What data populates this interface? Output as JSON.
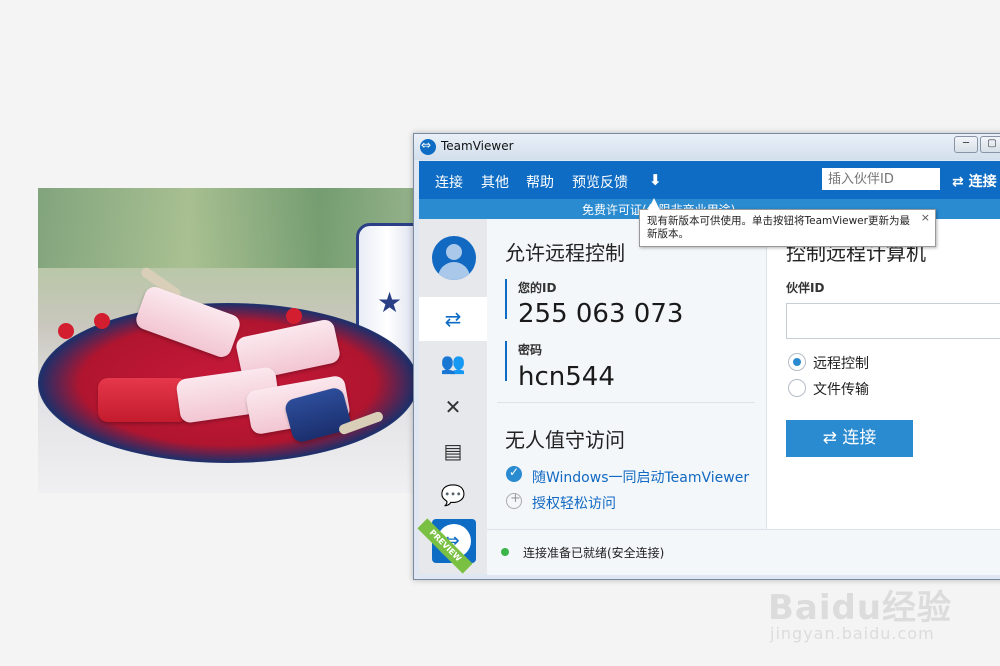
{
  "window": {
    "title": "TeamViewer",
    "min_label": "─",
    "max_label": "▢"
  },
  "menu": {
    "items": [
      "连接",
      "其他",
      "帮助",
      "预览反馈"
    ],
    "download_icon": "⬇",
    "partner_placeholder": "插入伙伴ID",
    "connect_label": "⇄ 连接"
  },
  "banner": {
    "text": "免费许可证(仅限非商业用途)"
  },
  "tooltip": {
    "text": "现有新版本可供使用。单击按钮将TeamViewer更新为最新版本。",
    "close": "×"
  },
  "sidebar": {
    "icons": [
      "arrows-icon",
      "meeting-icon",
      "expand-icon",
      "contacts-icon",
      "chat-icon"
    ],
    "glyphs": [
      "⇄",
      "👥",
      "✕",
      "▤",
      "💬"
    ],
    "ribbon": "PREVIEW"
  },
  "remote": {
    "title": "允许远程控制",
    "id_label": "您的ID",
    "id_value": "255 063 073",
    "pw_label": "密码",
    "pw_value": "hcn544"
  },
  "unattended": {
    "title": "无人值守访问",
    "option1": "随Windows一同启动TeamViewer",
    "option2": "授权轻松访问"
  },
  "control": {
    "title": "控制远程计算机",
    "partner_label": "伙伴ID",
    "radio1": "远程控制",
    "radio2": "文件传输",
    "connect_label": "⇄ 连接"
  },
  "status": {
    "text": "连接准备已就绪(安全连接)"
  },
  "watermark": {
    "main": "Baidu经验",
    "sub": "jingyan.baidu.com"
  }
}
